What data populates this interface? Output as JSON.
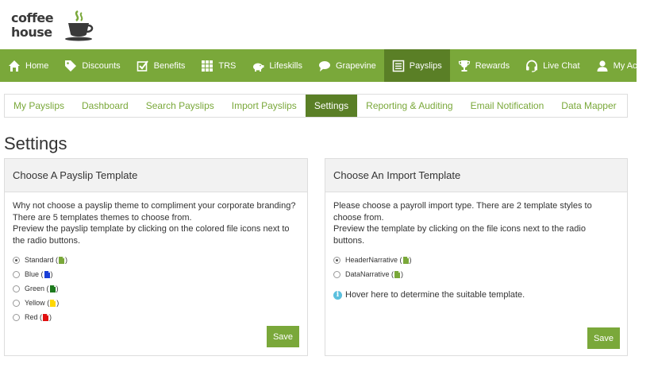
{
  "logo": {
    "line1": "coffee",
    "line2": "house"
  },
  "nav": {
    "items": [
      {
        "label": "Home",
        "icon": "home-icon"
      },
      {
        "label": "Discounts",
        "icon": "tag-icon"
      },
      {
        "label": "Benefits",
        "icon": "check-square-icon"
      },
      {
        "label": "TRS",
        "icon": "grid-icon"
      },
      {
        "label": "Lifeskills",
        "icon": "piggy-bank-icon"
      },
      {
        "label": "Grapevine",
        "icon": "speech-bubble-icon"
      },
      {
        "label": "Payslips",
        "icon": "list-icon"
      },
      {
        "label": "Rewards",
        "icon": "trophy-icon"
      }
    ],
    "live_chat": "Live Chat",
    "my_account": "My Account"
  },
  "subtabs": [
    "My Payslips",
    "Dashboard",
    "Search Payslips",
    "Import Payslips",
    "Settings",
    "Reporting & Auditing",
    "Email Notification",
    "Data Mapper"
  ],
  "page_title": "Settings",
  "payslip_panel": {
    "title": "Choose A Payslip Template",
    "text1": "Why not choose a payslip theme to compliment your corporate branding? There are 5 templates themes to choose from.",
    "text2": "Preview the payslip template by clicking on the colored file icons next to the radio buttons.",
    "options": [
      {
        "label": "Standard",
        "color": "#7aa83a",
        "checked": true
      },
      {
        "label": "Blue",
        "color": "#1a3fd6",
        "checked": false
      },
      {
        "label": "Green",
        "color": "#1e7a1e",
        "checked": false
      },
      {
        "label": "Yellow",
        "color": "#ffd800",
        "checked": false
      },
      {
        "label": "Red",
        "color": "#e01010",
        "checked": false
      }
    ],
    "save": "Save"
  },
  "import_panel": {
    "title": "Choose An Import Template",
    "text1": "Please choose a payroll import type. There are 2 template styles to choose from.",
    "text2": "Preview the template by clicking on the file icons next to the radio buttons.",
    "options": [
      {
        "label": "HeaderNarrative",
        "color": "#7aa83a",
        "checked": true
      },
      {
        "label": "DataNarrative",
        "color": "#7aa83a",
        "checked": false
      }
    ],
    "hint": "Hover here to determine the suitable template.",
    "save": "Save"
  },
  "colors": {
    "brand_green": "#7aa83a",
    "active_green": "#5a7f26"
  }
}
